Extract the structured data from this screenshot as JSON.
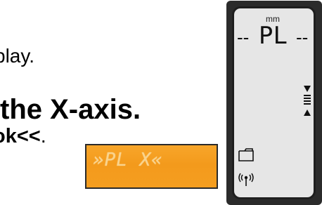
{
  "instructions": {
    "line1": "play.",
    "line2": "the X-axis.",
    "line3_bold": "ok<<",
    "line3_rest": "."
  },
  "lcd": {
    "text": "»PL X«",
    "background_color": "#f39a1c",
    "text_color": "#f9d48e"
  },
  "device": {
    "unit": "mm",
    "dash_left": "--",
    "mode": "PL",
    "dash_right": "--",
    "icons": [
      "level-arrows-icon",
      "folder-icon",
      "wireless-signal-icon"
    ],
    "screen_color": "#e6e6e6",
    "body_color": "#2b2b2b"
  }
}
